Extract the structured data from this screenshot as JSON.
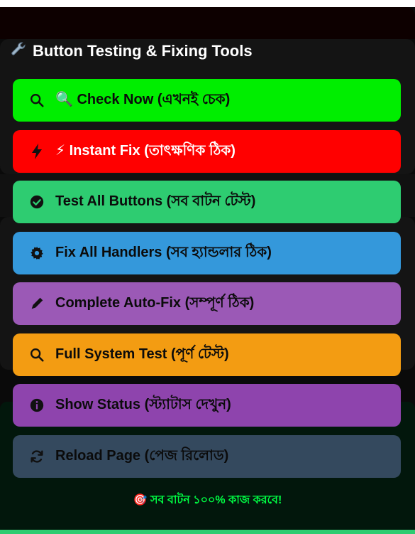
{
  "panel": {
    "title": "Button Testing & Fixing Tools",
    "title_icon": "wrench-icon"
  },
  "buttons": [
    {
      "label": "🔍 Check Now (এখনই চেক)",
      "icon": "search-icon",
      "color": "#00ee00"
    },
    {
      "label": "⚡ Instant Fix (তাৎক্ষণিক ঠিক)",
      "icon": "bolt-icon",
      "color": "#ff0000"
    },
    {
      "label": "Test All Buttons (সব বাটন টেস্ট)",
      "icon": "check-circle-icon",
      "color": "#2ecc71"
    },
    {
      "label": "Fix All Handlers (সব হ্যান্ডলার ঠিক)",
      "icon": "gear-icon",
      "color": "#3498db"
    },
    {
      "label": "Complete Auto-Fix (সম্পূর্ণ ঠিক)",
      "icon": "pencil-icon",
      "color": "#9b59b6"
    },
    {
      "label": "Full System Test (পূর্ণ টেস্ট)",
      "icon": "search-icon",
      "color": "#f39c12"
    },
    {
      "label": "Show Status (স্ট্যাটাস দেখুন)",
      "icon": "info-icon",
      "color": "#8e44ad"
    },
    {
      "label": "Reload Page (পেজ রিলোড)",
      "icon": "reload-icon",
      "color": "#34495e"
    }
  ],
  "footer": {
    "text": "🎯 সব বাটন ১০০% কাজ করবে!",
    "color": "#00ff44"
  }
}
